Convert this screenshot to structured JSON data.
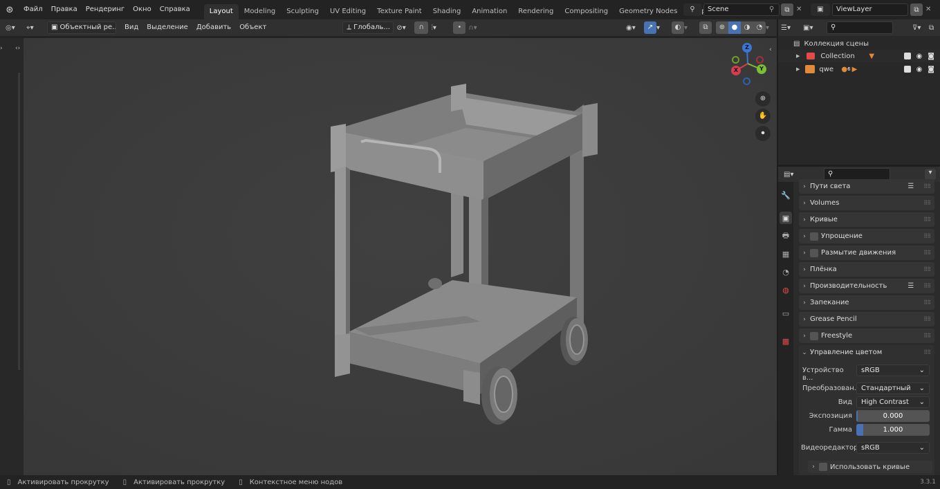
{
  "menu": {
    "items": [
      "Файл",
      "Правка",
      "Рендеринг",
      "Окно",
      "Справка"
    ]
  },
  "workspaces": {
    "tabs": [
      "Layout",
      "Modeling",
      "Sculpting",
      "UV Editing",
      "Texture Paint",
      "Shading",
      "Animation",
      "Rendering",
      "Compositing",
      "Geometry Nodes",
      "Scripting"
    ],
    "add_label": "+"
  },
  "scene": {
    "name": "Scene",
    "view_layer": "ViewLayer"
  },
  "viewport_header": {
    "mode": "Объектный ре...",
    "view": "Вид",
    "select": "Выделение",
    "add": "Добавить",
    "object": "Объект",
    "orientation": "Глобаль..."
  },
  "gizmo": {
    "z": "Z",
    "x": "X",
    "y": "Y"
  },
  "outliner": {
    "root": "Коллекция сцены",
    "items": [
      {
        "name": "Collection"
      },
      {
        "name": "qwe",
        "badge": "6"
      }
    ]
  },
  "properties": {
    "sections": [
      {
        "label": "Пути света",
        "checkbox": false,
        "list_icon": true
      },
      {
        "label": "Volumes",
        "checkbox": false
      },
      {
        "label": "Кривые",
        "checkbox": false
      },
      {
        "label": "Упрощение",
        "checkbox": true
      },
      {
        "label": "Размытие движения",
        "checkbox": true
      },
      {
        "label": "Плёнка",
        "checkbox": false
      },
      {
        "label": "Производительность",
        "checkbox": false,
        "list_icon": true
      },
      {
        "label": "Запекание",
        "checkbox": false
      },
      {
        "label": "Grease Pencil",
        "checkbox": false
      },
      {
        "label": "Freestyle",
        "checkbox": true
      }
    ],
    "color_management": {
      "title": "Управление цветом",
      "display_label": "Устройство в...",
      "display_value": "sRGB",
      "transform_label": "Преобразован...",
      "transform_value": "Стандартный",
      "look_label": "Вид",
      "look_value": "High Contrast",
      "exposure_label": "Экспозиция",
      "exposure_value": "0.000",
      "exposure_fill": 0.02,
      "gamma_label": "Гамма",
      "gamma_value": "1.000",
      "gamma_fill": 0.09,
      "sequencer_label": "Видеоредактор",
      "sequencer_value": "sRGB",
      "curves_label": "Использовать кривые"
    }
  },
  "statusbar": {
    "items": [
      "Активировать прокрутку",
      "Активировать прокрутку",
      "Контекстное меню нодов"
    ],
    "version": "3.3.1"
  },
  "colors": {
    "accent_blue": "#4772b3",
    "active_tab": "#303030",
    "viewport_bg": "#3d3d3d"
  }
}
